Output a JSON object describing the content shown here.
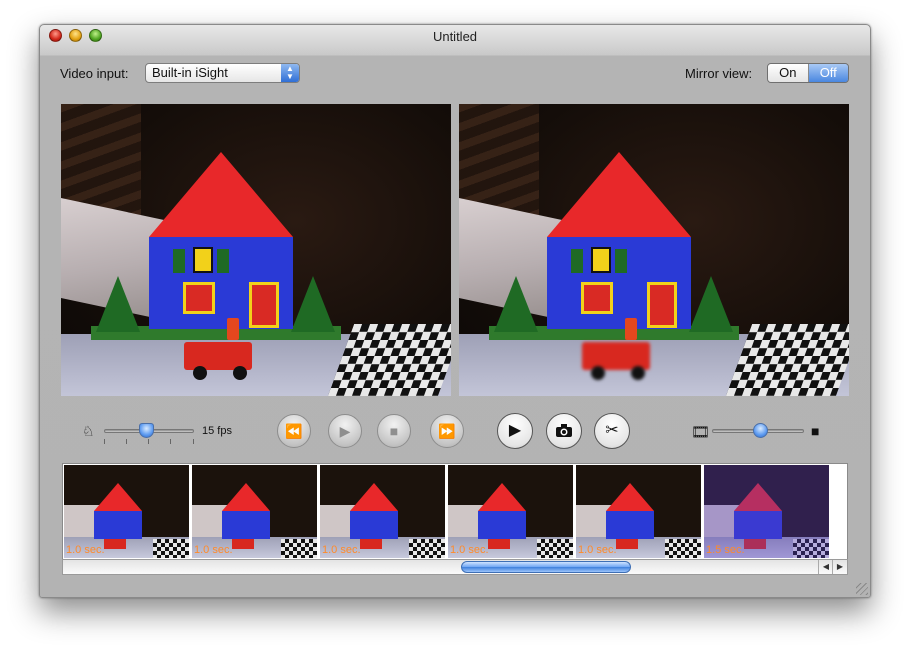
{
  "window": {
    "title": "Untitled"
  },
  "toolbar": {
    "video_input_label": "Video input:",
    "video_input_value": "Built-in iSight",
    "mirror_label": "Mirror view:",
    "mirror_options": [
      "On",
      "Off"
    ],
    "mirror_selected": "Off"
  },
  "controls": {
    "fps_label": "15 fps",
    "fps_slider_level": 0.47,
    "zoom_slider_level": 0.52,
    "buttons": [
      "rewind",
      "play",
      "stop",
      "fast-forward",
      "play-movie",
      "snapshot",
      "cut"
    ]
  },
  "filmstrip": {
    "frames": [
      {
        "duration": "1.0 sec.",
        "tinted": false
      },
      {
        "duration": "1.0 sec.",
        "tinted": false
      },
      {
        "duration": "1.0 sec.",
        "tinted": false
      },
      {
        "duration": "1.0 sec.",
        "tinted": false
      },
      {
        "duration": "1.0 sec.",
        "tinted": false
      },
      {
        "duration": "1.5 sec.",
        "tinted": true
      }
    ],
    "scroll_position": 0.68
  },
  "colors": {
    "selected_segment": "#4a87e0",
    "duration_text": "#ff8a2a",
    "knob": "#5c9af0"
  }
}
